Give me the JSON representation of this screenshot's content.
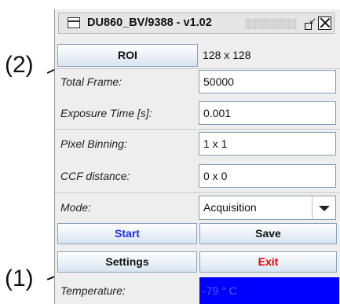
{
  "callouts": {
    "top": "(2)",
    "bottom": "(1)"
  },
  "window": {
    "title": "DU860_BV/9388 - v1.02",
    "icons": {
      "app": "window-icon",
      "restore": "restore-icon",
      "close": "close-icon"
    }
  },
  "roi": {
    "button_label": "ROI",
    "value": "128 x 128"
  },
  "fields": {
    "total_frame": {
      "label": "Total Frame:",
      "value": "50000"
    },
    "exposure_time": {
      "label": "Exposure Time [s]:",
      "value": "0.001"
    },
    "pixel_binning": {
      "label": "Pixel Binning:",
      "value": "1 x 1"
    },
    "ccf_distance": {
      "label": "CCF distance:",
      "value": "0 x 0"
    }
  },
  "mode": {
    "label": "Mode:",
    "selected": "Acquisition"
  },
  "buttons": {
    "start": "Start",
    "save": "Save",
    "settings": "Settings",
    "exit": "Exit"
  },
  "temperature": {
    "label": "Temperature:",
    "value": "-79 ° C"
  },
  "colors": {
    "start_text": "#1a2ee6",
    "exit_text": "#e60000",
    "temperature_bg": "#0000ff"
  }
}
